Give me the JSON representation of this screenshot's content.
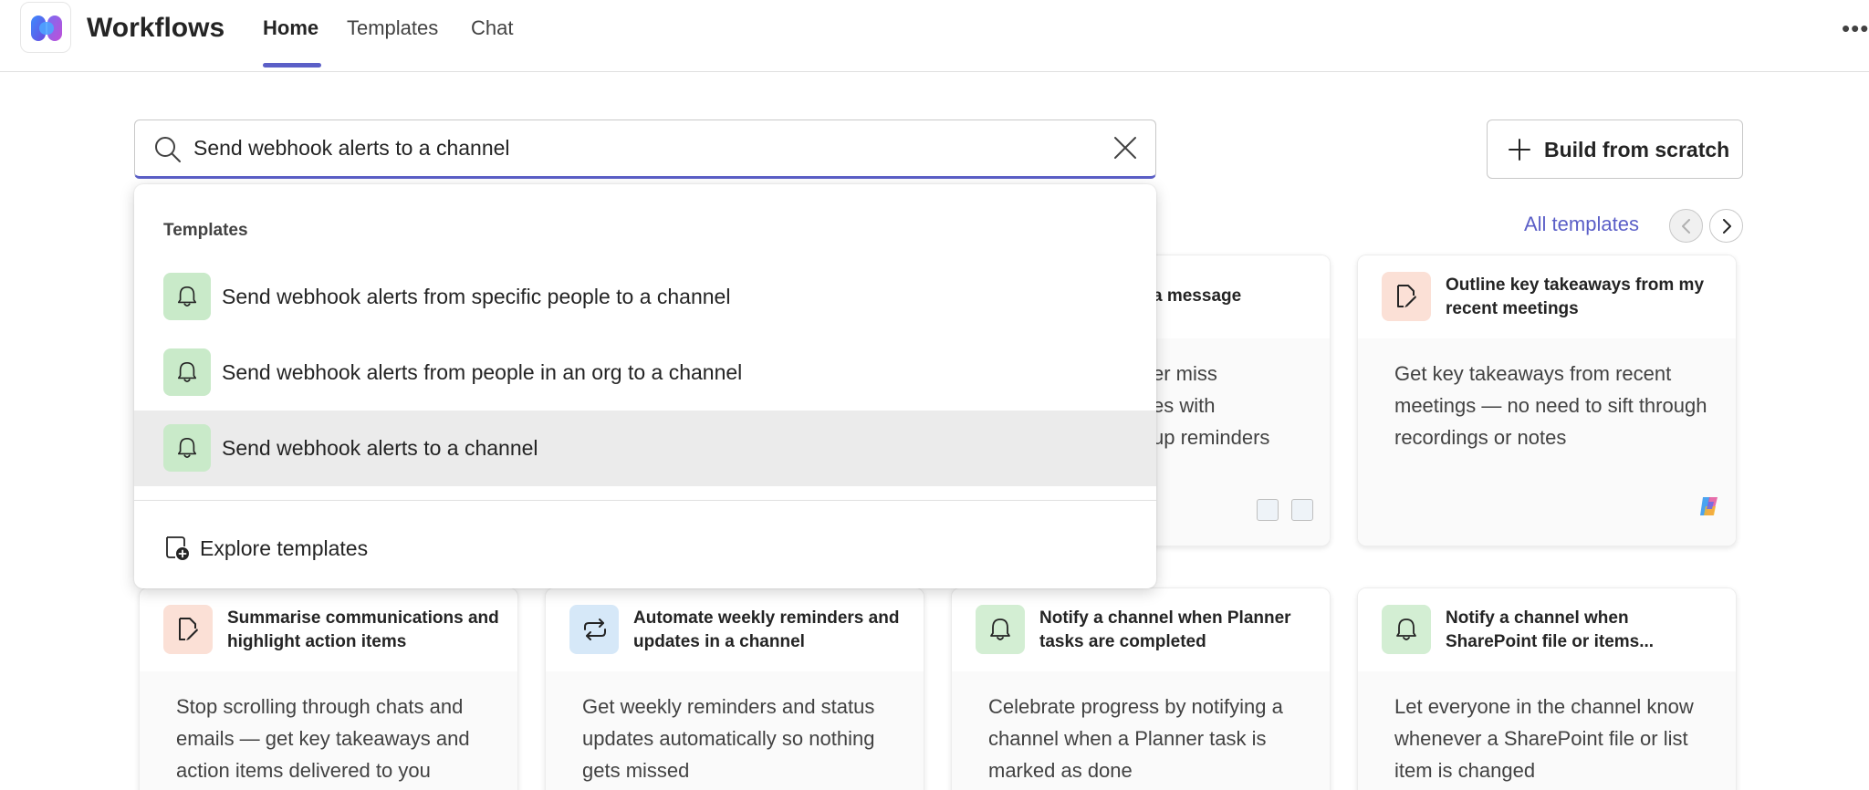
{
  "header": {
    "app_title": "Workflows",
    "tabs": [
      {
        "label": "Home",
        "active": true
      },
      {
        "label": "Templates",
        "active": false
      },
      {
        "label": "Chat",
        "active": false
      }
    ],
    "more_label": "•••"
  },
  "search": {
    "value": "Send webhook alerts to a channel",
    "placeholder": ""
  },
  "build_button": {
    "label": "Build from scratch"
  },
  "all_templates_link": "All templates",
  "dropdown": {
    "heading": "Templates",
    "items": [
      {
        "label": "Send webhook alerts from specific people to a channel",
        "icon": "bell-icon",
        "selected": false
      },
      {
        "label": "Send webhook alerts from people in an org to a channel",
        "icon": "bell-icon",
        "selected": false
      },
      {
        "label": "Send webhook alerts to a channel",
        "icon": "bell-icon",
        "selected": true
      }
    ],
    "explore_label": "Explore templates"
  },
  "cards_row1": [
    {
      "title": "a message",
      "description": "er miss\nes with\nup reminders"
    },
    {
      "title": "Outline key takeaways from my recent meetings",
      "description": "Get key takeaways from recent meetings — no need to sift through recordings or notes",
      "icon": "edit-note-icon"
    }
  ],
  "cards_row2": [
    {
      "title": "Summarise communications and highlight action items",
      "description": "Stop scrolling through chats and emails — get key takeaways and action items delivered to you",
      "icon": "edit-note-icon"
    },
    {
      "title": "Automate weekly reminders and updates in a channel",
      "description": "Get weekly reminders and status updates automatically so nothing gets missed",
      "icon": "repeat-icon"
    },
    {
      "title": "Notify a channel when Planner tasks are completed",
      "description": "Celebrate progress by notifying a channel when a Planner task is marked as done",
      "icon": "bell-icon"
    },
    {
      "title": "Notify a channel when SharePoint file or items...",
      "description": "Let everyone in the channel know whenever a SharePoint file or list item is changed",
      "icon": "bell-icon"
    }
  ],
  "colors": {
    "accent": "#5b5fc7",
    "tile_green": "#d3eed3",
    "tile_peach": "#fbe0d6",
    "tile_blue": "#d6e8f8"
  }
}
